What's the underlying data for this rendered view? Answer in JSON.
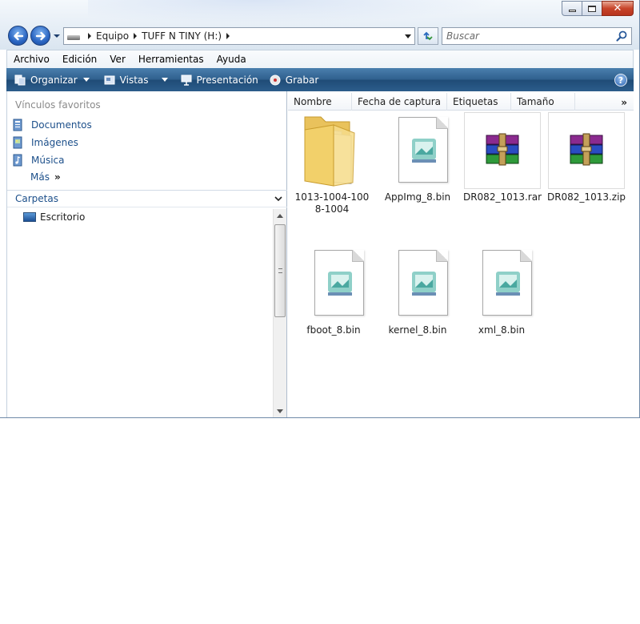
{
  "window": {
    "controls": {
      "minimize": "minimize",
      "maximize": "maximize",
      "close": "✕"
    }
  },
  "address": {
    "crumbs": [
      "Equipo",
      "TUFF N TINY (H:)"
    ]
  },
  "search": {
    "placeholder": "Buscar"
  },
  "menubar": {
    "items": [
      "Archivo",
      "Edición",
      "Ver",
      "Herramientas",
      "Ayuda"
    ]
  },
  "commandbar": {
    "organize": "Organizar",
    "views": "Vistas",
    "slideshow": "Presentación",
    "burn": "Grabar",
    "help": "?"
  },
  "navpane": {
    "favorites_title": "Vínculos favoritos",
    "favorites": [
      "Documentos",
      "Imágenes",
      "Música"
    ],
    "more": "Más",
    "folders_label": "Carpetas",
    "tree": [
      "Escritorio"
    ]
  },
  "filepane": {
    "columns": [
      "Nombre",
      "Fecha de captura",
      "Etiquetas",
      "Tamaño"
    ],
    "files": [
      {
        "name": "1013-1004-1008-1004",
        "type": "folder"
      },
      {
        "name": "AppImg_8.bin",
        "type": "bin"
      },
      {
        "name": "DR082_1013.rar",
        "type": "rar"
      },
      {
        "name": "DR082_1013.zip",
        "type": "rar"
      },
      {
        "name": "fboot_8.bin",
        "type": "bin"
      },
      {
        "name": "kernel_8.bin",
        "type": "bin"
      },
      {
        "name": "xml_8.bin",
        "type": "bin"
      }
    ]
  },
  "colors": {
    "commandbar": "#2f5f8d",
    "link": "#1c4f8a",
    "close_button": "#c7452a"
  }
}
